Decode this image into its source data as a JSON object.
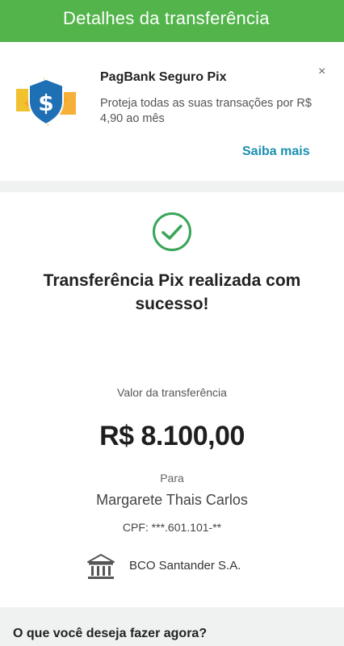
{
  "header": {
    "title": "Detalhes da transferência"
  },
  "promo": {
    "icon": "shield-dollar-icon",
    "title": "PagBank Seguro Pix",
    "text": "Proteja todas as suas transações por R$ 4,90 ao mês",
    "close": "×",
    "link": "Saiba mais"
  },
  "receipt": {
    "status_icon": "check-circle-icon",
    "title": "Transferência Pix realizada com sucesso!",
    "amount_label": "Valor da transferência",
    "amount": "R$ 8.100,00",
    "para_label": "Para",
    "recipient": "Margarete Thais Carlos",
    "cpf": "CPF: ***.601.101-**",
    "bank_icon": "bank-icon",
    "bank": "BCO Santander S.A."
  },
  "next": {
    "title": "O que você deseja fazer agora?"
  },
  "colors": {
    "header_bg": "#52b44a",
    "link": "#1a8fb0",
    "success": "#3aa55a"
  }
}
